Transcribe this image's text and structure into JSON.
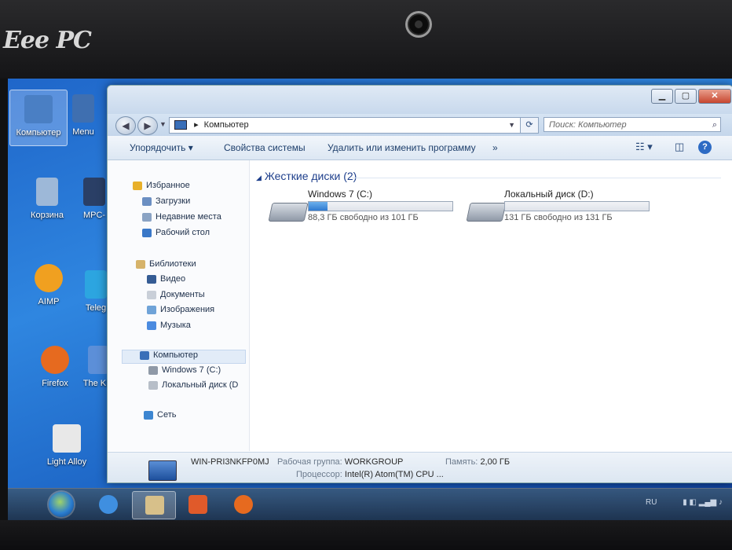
{
  "device": {
    "brand": "Eee PC"
  },
  "desktop": {
    "icons": [
      {
        "label": "Компьютер",
        "color": "#4a7fc4"
      },
      {
        "label": "Menu",
        "color": "#3f6fb0"
      },
      {
        "label": "Корзина",
        "color": "#9db8d8"
      },
      {
        "label": "MPC-",
        "color": "#2a3f66"
      },
      {
        "label": "AIMP",
        "color": "#f0a020"
      },
      {
        "label": "Teleg",
        "color": "#2ca5e0"
      },
      {
        "label": "Firefox",
        "color": "#e66a1f"
      },
      {
        "label": "The KM",
        "color": "#5c8fd8"
      },
      {
        "label": "Light Alloy",
        "color": "#e8e8e8"
      }
    ]
  },
  "window": {
    "address": {
      "path_item": "Компьютер",
      "separator": "▸"
    },
    "search_placeholder": "Поиск: Компьютер",
    "toolbar": {
      "organize": "Упорядочить ▾",
      "system_properties": "Свойства системы",
      "uninstall": "Удалить или изменить программу",
      "more": "»"
    },
    "nav": {
      "favorites": {
        "label": "Избранное",
        "items": [
          "Загрузки",
          "Недавние места",
          "Рабочий стол"
        ]
      },
      "libraries": {
        "label": "Библиотеки",
        "items": [
          "Видео",
          "Документы",
          "Изображения",
          "Музыка"
        ]
      },
      "computer": {
        "label": "Компьютер",
        "items": [
          "Windows 7 (C:)",
          "Локальный диск (D"
        ]
      },
      "network": {
        "label": "Сеть"
      }
    },
    "content": {
      "group_title": "Жесткие диски (2)",
      "drives": [
        {
          "name": "Windows 7 (C:)",
          "free_text": "88,3 ГБ свободно из 101 ГБ",
          "used_fraction": 0.13
        },
        {
          "name": "Локальный диск (D:)",
          "free_text": "131 ГБ свободно из 131 ГБ",
          "used_fraction": 0.0
        }
      ]
    },
    "details": {
      "computer_name": "WIN-PRI3NKFP0MJ",
      "workgroup_label": "Рабочая группа:",
      "workgroup_value": "WORKGROUP",
      "memory_label": "Память:",
      "memory_value": "2,00 ГБ",
      "cpu_label": "Процессор:",
      "cpu_value": "Intel(R) Atom(TM) CPU ..."
    }
  },
  "taskbar": {
    "language": "RU"
  }
}
